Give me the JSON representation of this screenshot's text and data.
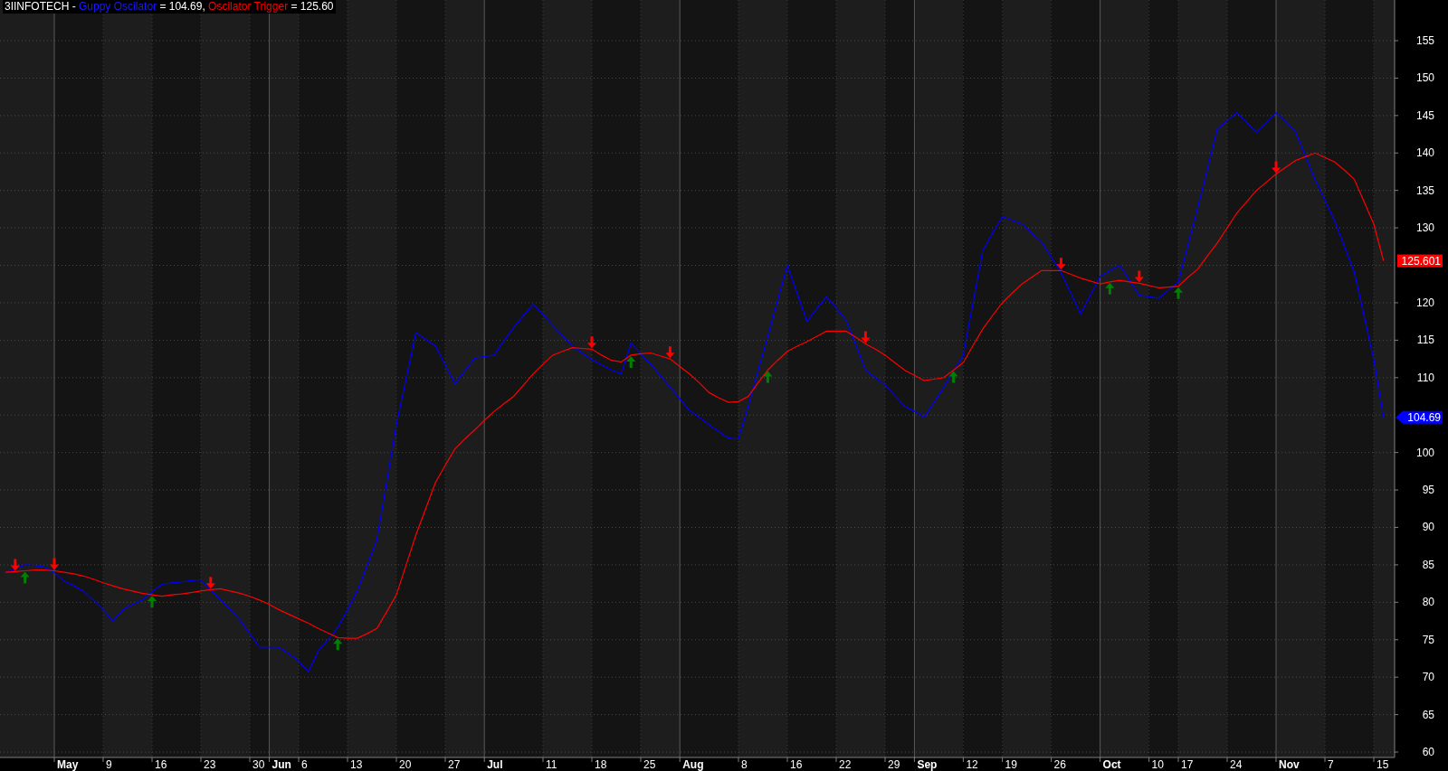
{
  "chart": {
    "last_value_labels": [
      "125.601",
      "104.69"
    ],
    "legend_values": [
      "= 104.69,",
      "= 125.60"
    ],
    "chart_data": {
      "type": "line",
      "title": "3IINFOTECH -",
      "grid": true,
      "categories": [
        null,
        null,
        null,
        null,
        null,
        null,
        "May",
        null,
        null,
        null,
        null,
        "9",
        null,
        null,
        null,
        null,
        "16",
        null,
        null,
        null,
        null,
        "23",
        null,
        null,
        null,
        null,
        "30",
        null,
        "Jun",
        null,
        null,
        "6",
        null,
        null,
        null,
        null,
        "13",
        null,
        null,
        null,
        null,
        "20",
        null,
        null,
        null,
        null,
        "27",
        null,
        null,
        null,
        "Jul",
        null,
        null,
        null,
        null,
        null,
        "11",
        null,
        null,
        null,
        null,
        "18",
        null,
        null,
        null,
        null,
        "25",
        null,
        null,
        null,
        "Aug",
        null,
        null,
        null,
        null,
        null,
        "8",
        null,
        null,
        null,
        null,
        "16",
        null,
        null,
        null,
        null,
        "22",
        null,
        null,
        null,
        null,
        "29",
        null,
        null,
        "Sep",
        null,
        null,
        null,
        null,
        "12",
        null,
        null,
        null,
        "19",
        null,
        null,
        null,
        null,
        "26",
        null,
        null,
        null,
        null,
        "Oct",
        null,
        null,
        null,
        null,
        "10",
        null,
        null,
        "17",
        null,
        null,
        null,
        null,
        "24",
        null,
        null,
        null,
        null,
        "Nov",
        null,
        null,
        null,
        null,
        "7",
        null,
        null,
        null,
        null,
        "15"
      ],
      "series": [
        {
          "name": "Guppy Oscilator",
          "color": "#0000ff",
          "values": [
            84,
            84.5,
            85,
            84.9,
            84.7,
            84,
            82.8,
            82.2,
            81.5,
            80.3,
            79,
            77.5,
            79,
            79.7,
            80.3,
            81.4,
            82.4,
            82.6,
            82.7,
            82.9,
            83,
            81.7,
            80.3,
            79,
            77.6,
            75.8,
            74,
            74,
            74,
            73.1,
            72.2,
            70.7,
            73.5,
            75,
            76.6,
            79,
            81.5,
            84.9,
            88.3,
            96,
            103.7,
            109.9,
            116,
            115.1,
            114.2,
            111.7,
            109.2,
            110.9,
            112.6,
            112.8,
            113,
            114.9,
            116.7,
            118.3,
            119.8,
            118.4,
            117,
            115.6,
            114.2,
            113.3,
            112.4,
            111.7,
            111,
            110.5,
            114.6,
            113.2,
            111.8,
            110.3,
            108.7,
            107.2,
            105.6,
            104.7,
            103.7,
            102.8,
            101.9,
            101.8,
            106.2,
            110.9,
            115.5,
            120.3,
            125,
            121.3,
            117.5,
            119.2,
            120.8,
            119.3,
            117.7,
            114.4,
            111,
            110,
            109,
            107.6,
            106.2,
            105.5,
            104.7,
            106.7,
            108.7,
            110.9,
            113,
            120,
            127,
            129.3,
            131.5,
            131,
            130.5,
            129.3,
            128.1,
            126.1,
            124,
            121.3,
            118.5,
            121,
            123.5,
            124.3,
            125,
            123,
            121,
            120.8,
            120.6,
            121.7,
            122.8,
            127.8,
            132.7,
            138,
            143.2,
            144.3,
            145.4,
            144.1,
            142.8,
            144.1,
            145.4,
            144.1,
            142.8,
            139.6,
            136.4,
            133.7,
            130.9,
            127.5,
            124.1,
            118.3,
            112.4,
            104.7
          ]
        },
        {
          "name": "Oscilator Trigger",
          "color": "#ff0000",
          "values": [
            84,
            84.1,
            84.2,
            84.3,
            84.3,
            84.2,
            84,
            83.8,
            83.5,
            83.1,
            82.6,
            82.2,
            81.8,
            81.5,
            81.2,
            81,
            80.8,
            81,
            81.1,
            81.3,
            81.5,
            81.7,
            81.8,
            81.5,
            81.2,
            80.8,
            80.3,
            79.7,
            79,
            78.4,
            77.8,
            77.2,
            76.5,
            75.9,
            75.3,
            75.2,
            75.2,
            75.8,
            76.5,
            78.7,
            81,
            85,
            89,
            92.5,
            96,
            98.3,
            100.5,
            101.8,
            103,
            104.3,
            105.5,
            106.5,
            107.5,
            109,
            110.5,
            111.8,
            113,
            113.5,
            114,
            113.9,
            113.8,
            113,
            112.3,
            112.1,
            113,
            113.2,
            113.3,
            112.9,
            112.5,
            111.5,
            110.5,
            109.3,
            108,
            107.3,
            106.7,
            106.8,
            107.5,
            109.3,
            111,
            112.3,
            113.5,
            114.2,
            114.8,
            115.5,
            116.2,
            116.2,
            116.2,
            115.4,
            114.5,
            113.8,
            113,
            112,
            111,
            110.3,
            109.6,
            109.8,
            110,
            111,
            112,
            114.3,
            116.5,
            118.3,
            120,
            121.3,
            122.5,
            123.4,
            124.3,
            124.3,
            124.3,
            123.8,
            123.3,
            122.9,
            122.5,
            122.8,
            123,
            122.8,
            122.6,
            122.3,
            122,
            122.1,
            122.2,
            123.4,
            124.5,
            126.3,
            128,
            130,
            132,
            133.5,
            135,
            136.1,
            137.2,
            138.1,
            139,
            139.5,
            140,
            139.4,
            138.8,
            137.7,
            136.5,
            133.5,
            130.5,
            125.6
          ]
        },
        {
          "type": "scatter",
          "color": "#ff0000",
          "values": [
            null,
            85,
            null,
            null,
            null,
            85.1,
            null,
            null,
            null,
            null,
            null,
            null,
            null,
            null,
            null,
            null,
            null,
            null,
            null,
            null,
            null,
            82.6,
            null,
            null,
            null,
            null,
            null,
            null,
            null,
            null,
            null,
            null,
            null,
            null,
            null,
            null,
            null,
            null,
            null,
            null,
            null,
            null,
            null,
            null,
            null,
            null,
            null,
            null,
            null,
            null,
            null,
            null,
            null,
            null,
            null,
            null,
            null,
            null,
            null,
            null,
            114.7,
            null,
            null,
            null,
            null,
            null,
            null,
            null,
            113.4,
            null,
            null,
            null,
            null,
            null,
            null,
            null,
            null,
            null,
            null,
            null,
            null,
            null,
            null,
            null,
            null,
            null,
            null,
            null,
            115.4,
            null,
            null,
            null,
            null,
            null,
            null,
            null,
            null,
            null,
            null,
            null,
            null,
            null,
            null,
            null,
            null,
            null,
            null,
            null,
            125.2,
            null,
            null,
            null,
            null,
            null,
            null,
            null,
            123.5,
            null,
            null,
            null,
            null,
            null,
            null,
            null,
            null,
            null,
            null,
            null,
            null,
            null,
            138.1,
            null,
            null,
            null,
            null,
            null,
            null,
            null,
            null,
            null,
            null,
            null
          ]
        },
        {
          "type": "scatter",
          "color": "#008000",
          "values": [
            null,
            null,
            83.3,
            null,
            null,
            null,
            null,
            null,
            null,
            null,
            null,
            null,
            null,
            null,
            null,
            80.1,
            null,
            null,
            null,
            null,
            null,
            null,
            null,
            null,
            null,
            null,
            null,
            null,
            null,
            null,
            null,
            null,
            null,
            null,
            74.4,
            null,
            null,
            null,
            null,
            null,
            null,
            null,
            null,
            null,
            null,
            null,
            null,
            null,
            null,
            null,
            null,
            null,
            null,
            null,
            null,
            null,
            null,
            null,
            null,
            null,
            null,
            null,
            null,
            null,
            112.1,
            null,
            null,
            null,
            null,
            null,
            null,
            null,
            null,
            null,
            null,
            null,
            null,
            null,
            110.1,
            null,
            null,
            null,
            null,
            null,
            null,
            null,
            null,
            null,
            null,
            null,
            null,
            null,
            null,
            null,
            null,
            null,
            null,
            110.1,
            null,
            null,
            null,
            null,
            null,
            null,
            null,
            null,
            null,
            null,
            null,
            null,
            null,
            null,
            null,
            121.9,
            null,
            null,
            null,
            null,
            null,
            null,
            121.3,
            null,
            null,
            null,
            null,
            null,
            null,
            null,
            null,
            null,
            null,
            null,
            null,
            null,
            null,
            null,
            null,
            null,
            null,
            null,
            null,
            null
          ]
        }
      ],
      "ylim": [
        59.28,
        160.43
      ],
      "yticks": [
        60,
        65,
        70,
        75,
        80,
        85,
        90,
        95,
        100,
        110,
        115,
        120,
        130,
        135,
        140,
        145,
        150,
        155
      ]
    }
  }
}
